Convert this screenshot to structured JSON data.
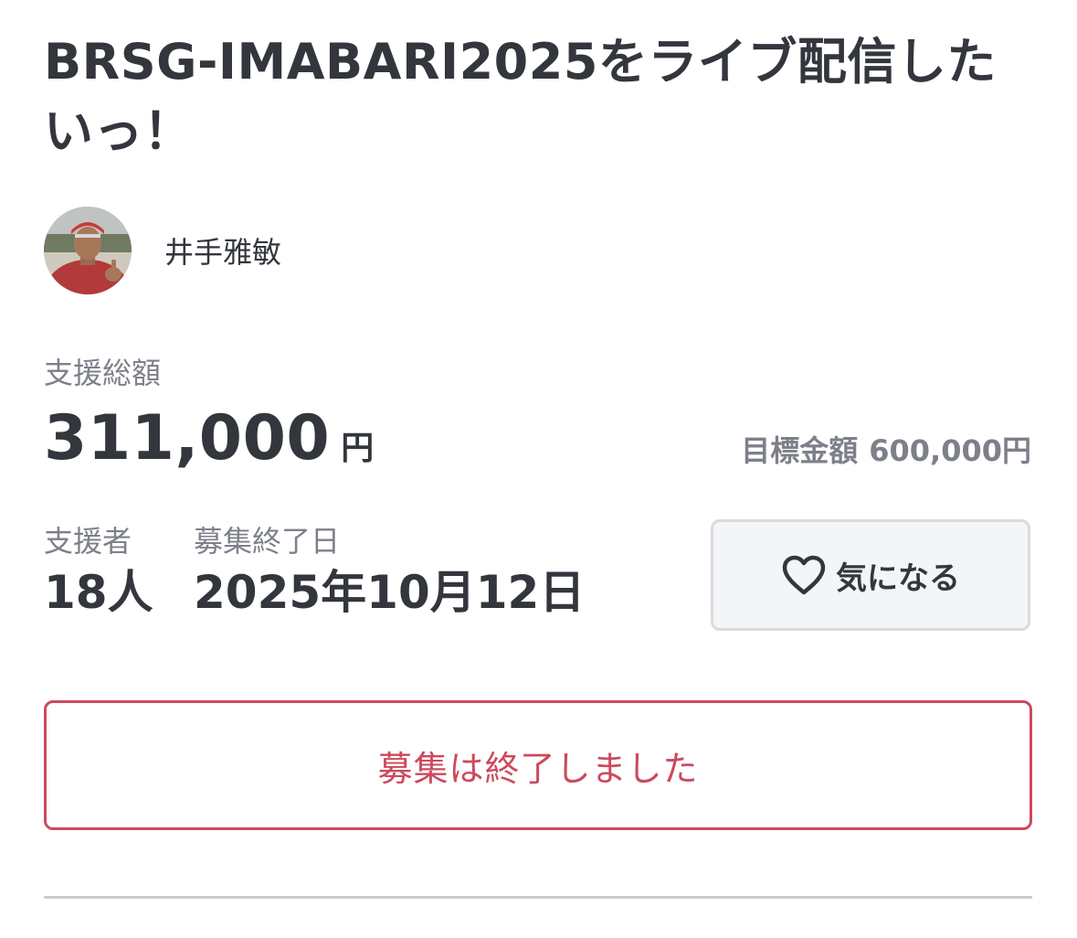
{
  "project": {
    "title": "BRSG-IMABARI2025をライブ配信したいっ！"
  },
  "owner": {
    "name": "井手雅敏"
  },
  "funding": {
    "total_label": "支援総額",
    "total_amount": "311,000",
    "total_unit": "円",
    "goal_label": "目標金額",
    "goal_amount": "600,000円"
  },
  "stats": {
    "supporters_label": "支援者",
    "supporters_value": "18人",
    "end_date_label": "募集終了日",
    "end_date_value": "2025年10月12日"
  },
  "actions": {
    "favorite_label": "気になる",
    "favorite_icon": "heart-outline-icon",
    "closed_label": "募集は終了しました"
  },
  "colors": {
    "text": "#33363d",
    "muted": "#7d8089",
    "closed_accent": "#cc4a5c",
    "favorite_bg": "#f4f5f7"
  }
}
